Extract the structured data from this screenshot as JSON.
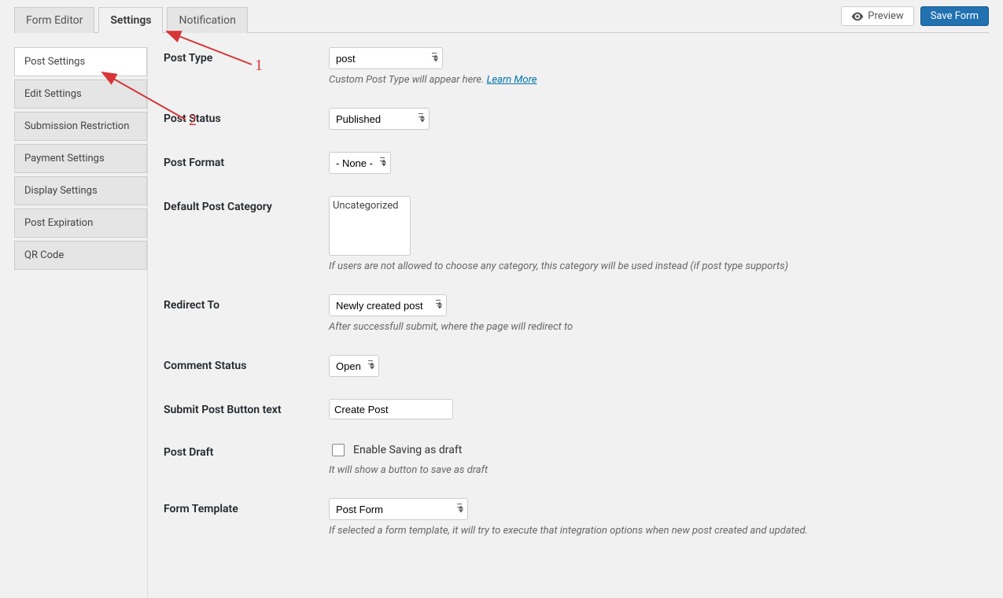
{
  "topTabs": {
    "formEditor": "Form Editor",
    "settings": "Settings",
    "notification": "Notification"
  },
  "buttons": {
    "preview": "Preview",
    "save": "Save Form"
  },
  "sidebar": {
    "items": [
      "Post Settings",
      "Edit Settings",
      "Submission Restriction",
      "Payment Settings",
      "Display Settings",
      "Post Expiration",
      "QR Code"
    ]
  },
  "fields": {
    "postType": {
      "label": "Post Type",
      "value": "post",
      "helper_pre": "Custom Post Type will appear here. ",
      "helper_link": "Learn More"
    },
    "postStatus": {
      "label": "Post Status",
      "value": "Published"
    },
    "postFormat": {
      "label": "Post Format",
      "value": "- None -"
    },
    "defaultCategory": {
      "label": "Default Post Category",
      "option": "Uncategorized",
      "helper": "If users are not allowed to choose any category, this category will be used instead (if post type supports)"
    },
    "redirectTo": {
      "label": "Redirect To",
      "value": "Newly created post",
      "helper": "After successfull submit, where the page will redirect to"
    },
    "commentStatus": {
      "label": "Comment Status",
      "value": "Open"
    },
    "submitText": {
      "label": "Submit Post Button text",
      "value": "Create Post"
    },
    "postDraft": {
      "label": "Post Draft",
      "checkbox": "Enable Saving as draft",
      "helper": "It will show a button to save as draft"
    },
    "formTemplate": {
      "label": "Form Template",
      "value": "Post Form",
      "helper": "If selected a form template, it will try to execute that integration options when new post created and updated."
    }
  },
  "annotations": {
    "one": "1",
    "two": "2"
  }
}
